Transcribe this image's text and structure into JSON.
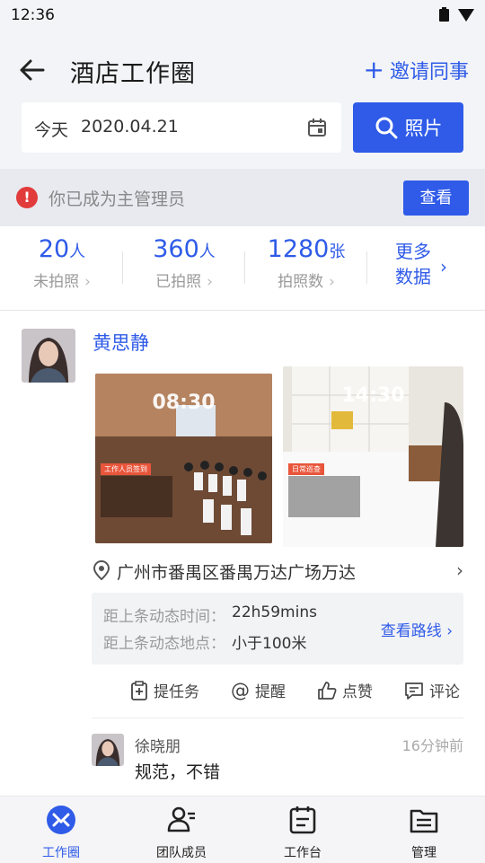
{
  "status_bar": {
    "time": "12:36"
  },
  "header": {
    "title": "酒店工作圈",
    "invite_label": "邀请同事",
    "date_label": "今天",
    "date_value": "2020.04.21",
    "photo_button_label": "照片"
  },
  "notice": {
    "text": "你已成为主管理员",
    "button_label": "查看"
  },
  "stats": [
    {
      "value": "20",
      "unit": "人",
      "label": "未拍照"
    },
    {
      "value": "360",
      "unit": "人",
      "label": "已拍照"
    },
    {
      "value": "1280",
      "unit": "张",
      "label": "拍照数"
    }
  ],
  "more_data": {
    "line1": "更多",
    "line2": "数据"
  },
  "post": {
    "author": "黄思静",
    "photos": [
      {
        "time": "08:30",
        "tag": "工作人员签到"
      },
      {
        "time": "14:30",
        "tag": "日常巡查"
      }
    ],
    "location": "广州市番禺区番禺万达广场万达",
    "info": {
      "time_label": "距上条动态时间：",
      "time_value": "22h59mins",
      "place_label": "距上条动态地点：",
      "place_value": "小于100米",
      "route_label": "查看路线"
    },
    "actions": {
      "task": "提任务",
      "remind": "提醒",
      "like": "点赞",
      "comment": "评论"
    },
    "comment": {
      "name": "徐晓朋",
      "time": "16分钟前",
      "text": "规范，不错"
    }
  },
  "bottom_nav": [
    {
      "label": "工作圈",
      "icon": "work-circle-icon",
      "active": true
    },
    {
      "label": "团队成员",
      "icon": "team-members-icon",
      "active": false
    },
    {
      "label": "工作台",
      "icon": "workbench-icon",
      "active": false
    },
    {
      "label": "管理",
      "icon": "management-icon",
      "active": false
    }
  ],
  "colors": {
    "accent": "#2f5be8",
    "warning": "#e23b3b"
  }
}
